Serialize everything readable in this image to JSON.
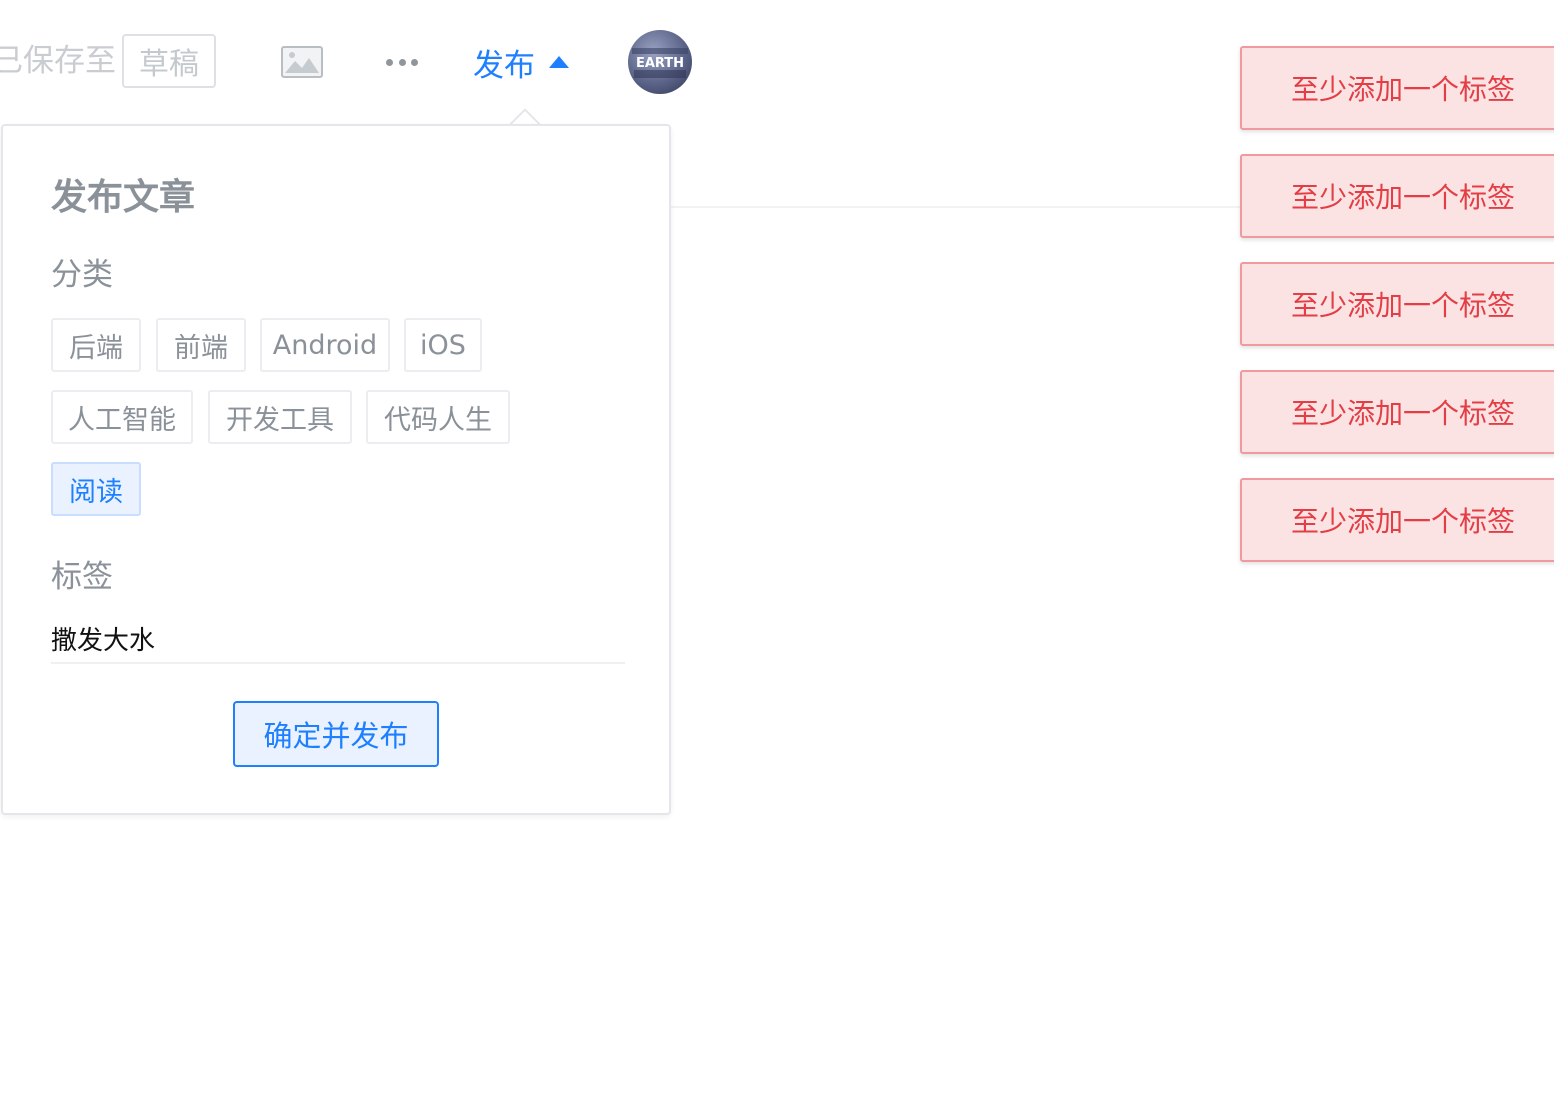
{
  "header": {
    "saved_text": "已保存至",
    "draft_label": "草稿",
    "image_icon": "image-icon",
    "more_icon": "more-icon",
    "publish_label": "发布",
    "caret_icon": "caret-up-icon",
    "avatar_text": "EARTH"
  },
  "popover": {
    "title": "发布文章",
    "category_label": "分类",
    "categories": [
      {
        "label": "后端",
        "active": false
      },
      {
        "label": "前端",
        "active": false
      },
      {
        "label": "Android",
        "active": false
      },
      {
        "label": "iOS",
        "active": false
      },
      {
        "label": "人工智能",
        "active": false
      },
      {
        "label": "开发工具",
        "active": false
      },
      {
        "label": "代码人生",
        "active": false
      },
      {
        "label": "阅读",
        "active": true
      }
    ],
    "tag_label": "标签",
    "tag_input_value": "撒发大水",
    "confirm_label": "确定并发布"
  },
  "toasts": [
    {
      "message": "至少添加一个标签"
    },
    {
      "message": "至少添加一个标签"
    },
    {
      "message": "至少添加一个标签"
    },
    {
      "message": "至少添加一个标签"
    },
    {
      "message": "至少添加一个标签"
    }
  ],
  "colors": {
    "accent": "#1e80ff",
    "muted_text": "#8a9199",
    "error_text": "#e33e45",
    "error_bg": "#fbe3e4",
    "error_border": "#ee9a9e"
  }
}
